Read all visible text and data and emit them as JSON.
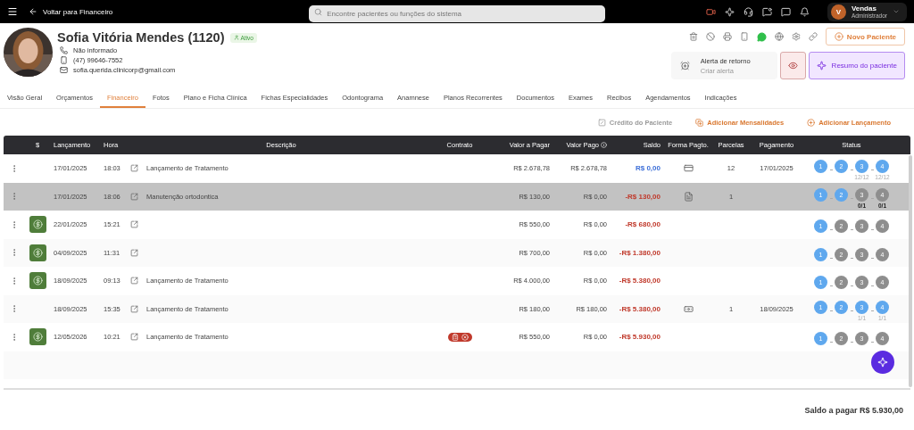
{
  "topbar": {
    "back_link": "Voltar para Financeiro",
    "search": {
      "placeholder": "Encontre pacientes ou funções do sistema"
    },
    "user": {
      "initial": "V",
      "name": "Vendas",
      "role": "Administrador"
    }
  },
  "patient": {
    "name": "Sofia Vitória Mendes (1120)",
    "status": "Ativo",
    "phone": "Não informado",
    "mobile": "(47) 99646-7552",
    "email": "sofia.querida.clinicorp@gmail.com"
  },
  "header_actions": {
    "new_patient": "Novo Paciente",
    "alert": {
      "title": "Alerta de retorno",
      "subtitle": "Criar alerta"
    },
    "summary": "Resumo do paciente"
  },
  "tabs": [
    {
      "label": "Visão Geral",
      "selected": false
    },
    {
      "label": "Orçamentos",
      "selected": false
    },
    {
      "label": "Financeiro",
      "selected": true
    },
    {
      "label": "Fotos",
      "selected": false
    },
    {
      "label": "Plano e Ficha Clínica",
      "selected": false
    },
    {
      "label": "Fichas Especialidades",
      "selected": false
    },
    {
      "label": "Odontograma",
      "selected": false
    },
    {
      "label": "Anamnese",
      "selected": false
    },
    {
      "label": "Planos Recorrentes",
      "selected": false
    },
    {
      "label": "Documentos",
      "selected": false
    },
    {
      "label": "Exames",
      "selected": false
    },
    {
      "label": "Recibos",
      "selected": false
    },
    {
      "label": "Agendamentos",
      "selected": false
    },
    {
      "label": "Indicações",
      "selected": false
    }
  ],
  "actions": [
    {
      "kind": "credit",
      "label": "Crédito do Paciente",
      "disabled": true
    },
    {
      "kind": "monthly",
      "label": "Adicionar Mensalidades",
      "disabled": false
    },
    {
      "kind": "add",
      "label": "Adicionar Lançamento",
      "disabled": false
    }
  ],
  "table": {
    "columns": [
      {
        "label": "$",
        "info": false
      },
      {
        "label": "Lançamento",
        "info": false
      },
      {
        "label": "Hora",
        "info": false
      },
      {
        "label": "Descrição",
        "info": false
      },
      {
        "label": "Contrato",
        "info": false
      },
      {
        "label": "Valor a Pagar",
        "info": false
      },
      {
        "label": "Valor Pago",
        "info": true
      },
      {
        "label": "Saldo",
        "info": false
      },
      {
        "label": "Forma Pagto.",
        "info": false
      },
      {
        "label": "Parcelas",
        "info": false
      },
      {
        "label": "Pagamento",
        "info": false
      },
      {
        "label": "Status",
        "info": false
      }
    ],
    "rows": [
      {
        "selected": false,
        "paid_badge": false,
        "date": "17/01/2025",
        "time": "18:03",
        "description": "Lançamento de Tratamento",
        "contract": false,
        "to_pay": "R$ 2.678,78",
        "paid": "R$ 2.678,78",
        "balance": {
          "text": "R$ 0,00",
          "color": "#3d6fd8"
        },
        "payment": {
          "kind": "card"
        },
        "installments": "12",
        "payment_date": "17/01/2025",
        "steps": [
          {
            "number": "1",
            "done": true
          },
          {
            "number": "2",
            "done": true
          },
          {
            "number": "3",
            "done": true,
            "note": "12/12"
          },
          {
            "number": "4",
            "done": true,
            "note": "12/12"
          }
        ]
      },
      {
        "selected": true,
        "paid_badge": false,
        "date": "17/01/2025",
        "time": "18:06",
        "description": "Manutenção ortodontica",
        "contract": false,
        "to_pay": "R$ 130,00",
        "paid": "R$ 0,00",
        "balance": {
          "text": "-R$ 130,00",
          "color": "#c0392b"
        },
        "payment": {
          "kind": "boleto"
        },
        "installments": "1",
        "steps": [
          {
            "number": "1",
            "done": true
          },
          {
            "number": "2",
            "done": true
          },
          {
            "number": "3",
            "done": false,
            "note": "0/1"
          },
          {
            "number": "4",
            "done": false,
            "note": "0/1"
          }
        ]
      },
      {
        "selected": false,
        "paid_badge": true,
        "date": "22/01/2025",
        "time": "15:21",
        "contract": false,
        "to_pay": "R$ 550,00",
        "paid": "R$ 0,00",
        "balance": {
          "text": "-R$ 680,00",
          "color": "#c0392b"
        },
        "steps": [
          {
            "number": "1",
            "done": true
          },
          {
            "number": "2",
            "done": false
          },
          {
            "number": "3",
            "done": false
          },
          {
            "number": "4",
            "done": false
          }
        ]
      },
      {
        "selected": false,
        "paid_badge": true,
        "date": "04/09/2025",
        "time": "11:31",
        "contract": false,
        "to_pay": "R$ 700,00",
        "paid": "R$ 0,00",
        "balance": {
          "text": "-R$ 1.380,00",
          "color": "#c0392b"
        },
        "steps": [
          {
            "number": "1",
            "done": true
          },
          {
            "number": "2",
            "done": false
          },
          {
            "number": "3",
            "done": false
          },
          {
            "number": "4",
            "done": false
          }
        ]
      },
      {
        "selected": false,
        "paid_badge": true,
        "date": "18/09/2025",
        "time": "09:13",
        "description": "Lançamento de Tratamento",
        "contract": false,
        "to_pay": "R$ 4.000,00",
        "paid": "R$ 0,00",
        "balance": {
          "text": "-R$ 5.380,00",
          "color": "#c0392b"
        },
        "steps": [
          {
            "number": "1",
            "done": true
          },
          {
            "number": "2",
            "done": false
          },
          {
            "number": "3",
            "done": false
          },
          {
            "number": "4",
            "done": false
          }
        ]
      },
      {
        "selected": false,
        "paid_badge": false,
        "date": "18/09/2025",
        "time": "15:35",
        "description": "Lançamento de Tratamento",
        "contract": false,
        "to_pay": "R$ 180,00",
        "paid": "R$ 180,00",
        "balance": {
          "text": "-R$ 5.380,00",
          "color": "#c0392b"
        },
        "payment": {
          "kind": "cash"
        },
        "installments": "1",
        "payment_date": "18/09/2025",
        "steps": [
          {
            "number": "1",
            "done": true
          },
          {
            "number": "2",
            "done": true
          },
          {
            "number": "3",
            "done": true,
            "note": "1/1"
          },
          {
            "number": "4",
            "done": true,
            "note": "1/1"
          }
        ]
      },
      {
        "selected": false,
        "paid_badge": true,
        "date": "12/05/2026",
        "time": "10:21",
        "description": "Lançamento de Tratamento",
        "contract": true,
        "to_pay": "R$ 550,00",
        "paid": "R$ 0,00",
        "balance": {
          "text": "-R$ 5.930,00",
          "color": "#c0392b"
        },
        "steps": [
          {
            "number": "1",
            "done": true
          },
          {
            "number": "2",
            "done": false
          },
          {
            "number": "3",
            "done": false
          },
          {
            "number": "4",
            "done": false
          }
        ]
      }
    ]
  },
  "footer": {
    "total": "Saldo a pagar R$ 5.930,00"
  }
}
